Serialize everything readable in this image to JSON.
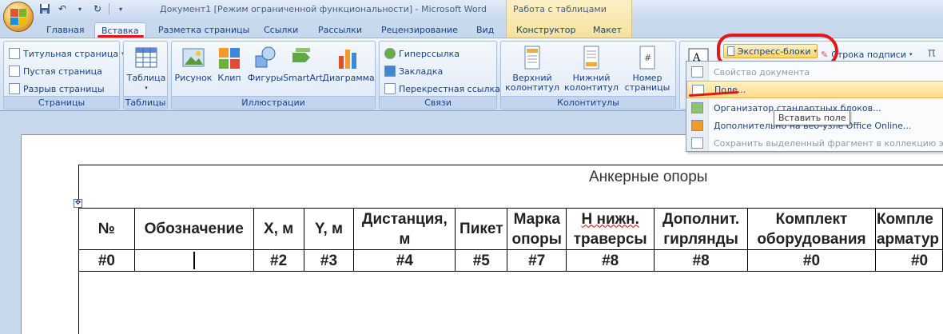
{
  "window": {
    "title": "Документ1 [Режим ограниченной функциональности] - Microsoft Word",
    "context_tool_title": "Работа с таблицами"
  },
  "tabs": [
    "Главная",
    "Вставка",
    "Разметка страницы",
    "Ссылки",
    "Рассылки",
    "Рецензирование",
    "Вид",
    "Конструктор",
    "Макет"
  ],
  "ribbon": {
    "pages": {
      "items": [
        "Титульная страница",
        "Пустая страница",
        "Разрыв страницы"
      ],
      "label": "Страницы"
    },
    "tables": {
      "button": "Таблица",
      "label": "Таблицы"
    },
    "illustrations": {
      "buttons": [
        "Рисунок",
        "Клип",
        "Фигуры",
        "SmartArt",
        "Диаграмма"
      ],
      "label": "Иллюстрации"
    },
    "links": {
      "items": [
        "Гиперссылка",
        "Закладка",
        "Перекрестная ссылка"
      ],
      "label": "Связи"
    },
    "header_footer": {
      "buttons": [
        {
          "line1": "Верхний",
          "line2": "колонтитул"
        },
        {
          "line1": "Нижний",
          "line2": "колонтитул"
        },
        {
          "line1": "Номер",
          "line2": "страницы"
        }
      ],
      "label": "Колонтитулы"
    },
    "text": {
      "express_blocks": "Экспресс-блоки",
      "signature_line": "Строка подписи",
      "pi_symbol": "π"
    }
  },
  "express_menu": {
    "items": [
      {
        "label": "Свойство документа",
        "disabled": true
      },
      {
        "label": "Поле...",
        "disabled": false
      },
      {
        "label": "Организатор стандартных блоков...",
        "disabled": false
      },
      {
        "label": "Дополнительно на веб-узле Office Online...",
        "disabled": false
      },
      {
        "label": "Сохранить выделенный фрагмент в коллекцию экспр",
        "disabled": true
      }
    ],
    "tooltip": "Вставить поле"
  },
  "document": {
    "table_title": "Анкерные опоры",
    "headers": [
      [
        "№"
      ],
      [
        "Обозначение"
      ],
      [
        "X, м"
      ],
      [
        "Y, м"
      ],
      [
        "Дистанция,",
        "м"
      ],
      [
        "Пикет"
      ],
      [
        "Марка",
        "опоры"
      ],
      [
        "Н нижн.",
        "траверсы"
      ],
      [
        "Дополнит.",
        "гирлянды"
      ],
      [
        "Комплект",
        "оборудования"
      ],
      [
        "Компле",
        "арматур"
      ]
    ],
    "values": [
      "#0",
      "",
      "#2",
      "#3",
      "#4",
      "#5",
      "#7",
      "#8",
      "#8",
      "#0",
      "#0"
    ]
  }
}
